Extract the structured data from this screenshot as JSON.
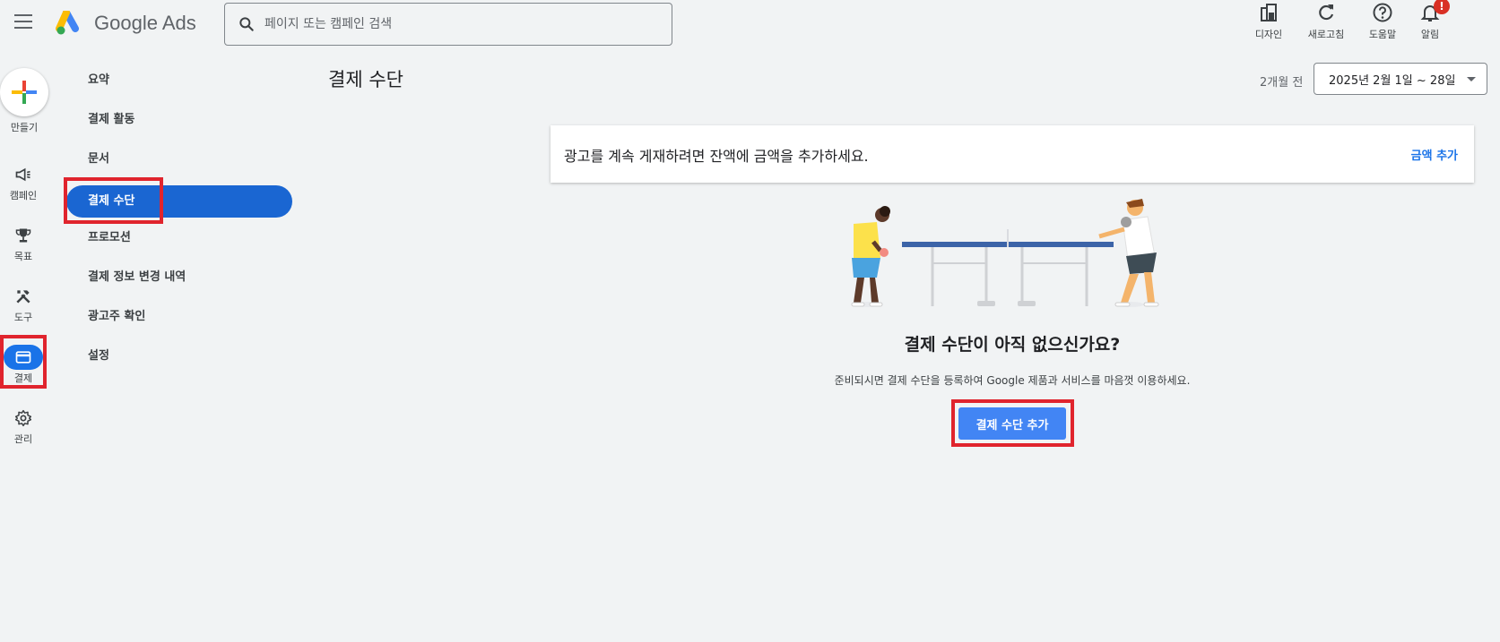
{
  "app": {
    "brand": "Google Ads"
  },
  "search": {
    "placeholder": "페이지 또는 캠페인 검색"
  },
  "top_actions": [
    {
      "label": "디자인",
      "icon": "appearance-icon"
    },
    {
      "label": "새로고침",
      "icon": "refresh-icon"
    },
    {
      "label": "도움말",
      "icon": "help-icon"
    },
    {
      "label": "알림",
      "icon": "bell-icon",
      "badge": "!"
    }
  ],
  "rail": {
    "create_label": "만들기",
    "items": [
      {
        "label": "캠페인",
        "icon": "megaphone-icon"
      },
      {
        "label": "목표",
        "icon": "trophy-icon"
      },
      {
        "label": "도구",
        "icon": "tools-icon"
      },
      {
        "label": "결제",
        "icon": "credit-card-icon",
        "active": true
      },
      {
        "label": "관리",
        "icon": "gear-icon"
      }
    ]
  },
  "subnav": {
    "items": [
      {
        "label": "요약"
      },
      {
        "label": "결제 활동"
      },
      {
        "label": "문서"
      },
      {
        "label": "결제 수단",
        "active": true
      },
      {
        "label": "프로모션"
      },
      {
        "label": "결제 정보 변경 내역"
      },
      {
        "label": "광고주 확인"
      },
      {
        "label": "설정"
      }
    ]
  },
  "main": {
    "title": "결제 수단",
    "range_label": "2개월 전",
    "date_range": "2025년 2월 1일 ~ 28일",
    "notice": {
      "message": "광고를 계속 게재하려면 잔액에 금액을 추가하세요.",
      "action": "금액 추가"
    },
    "empty_state": {
      "title": "결제 수단이 아직 없으신가요?",
      "description": "준비되시면 결제 수단을 등록하여 Google 제품과 서비스를 마음껏 이용하세요.",
      "button": "결제 수단 추가"
    }
  },
  "colors": {
    "accent": "#1a73e8",
    "active_nav": "#1a66d2",
    "button": "#4285f4",
    "highlight": "#e0242d",
    "badge": "#d93025"
  }
}
